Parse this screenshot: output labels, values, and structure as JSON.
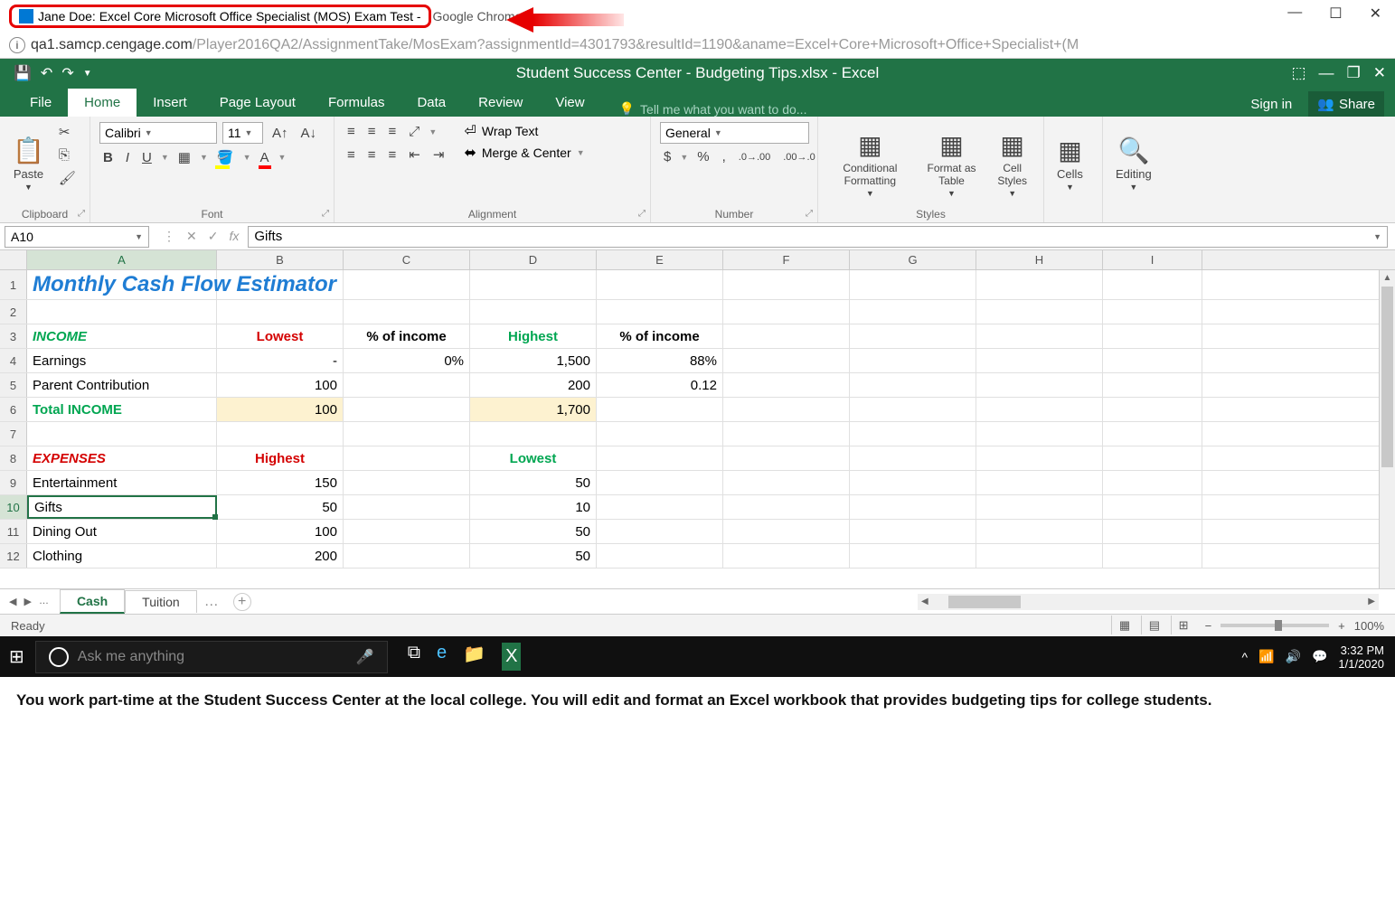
{
  "browser": {
    "title_highlighted": "Jane Doe: Excel Core Microsoft Office Specialist (MOS) Exam Test -",
    "title_rest": " Google Chrome",
    "url_host": "qa1.samcp.cengage.com",
    "url_path": "/Player2016QA2/AssignmentTake/MosExam?assignmentId=4301793&resultId=1190&aname=Excel+Core+Microsoft+Office+Specialist+(M",
    "win_minimize": "—",
    "win_maximize": "☐",
    "win_close": "✕"
  },
  "excel": {
    "doc_title": "Student Success Center - Budgeting Tips.xlsx - Excel",
    "tabs": [
      "File",
      "Home",
      "Insert",
      "Page Layout",
      "Formulas",
      "Data",
      "Review",
      "View"
    ],
    "active_tab": "Home",
    "tell_me": "Tell me what you want to do...",
    "sign_in": "Sign in",
    "share": "Share"
  },
  "ribbon": {
    "clipboard": {
      "label": "Clipboard",
      "paste": "Paste"
    },
    "font": {
      "label": "Font",
      "name": "Calibri",
      "size": "11",
      "bold": "B",
      "italic": "I",
      "underline": "U"
    },
    "alignment": {
      "label": "Alignment",
      "wrap": "Wrap Text",
      "merge": "Merge & Center"
    },
    "number": {
      "label": "Number",
      "format": "General"
    },
    "styles": {
      "label": "Styles",
      "cond": "Conditional Formatting",
      "table": "Format as Table",
      "cell": "Cell Styles"
    },
    "cells": {
      "label": "Cells"
    },
    "editing": {
      "label": "Editing"
    }
  },
  "formula_bar": {
    "name_box": "A10",
    "formula": "Gifts"
  },
  "grid": {
    "columns": [
      "A",
      "B",
      "C",
      "D",
      "E",
      "F",
      "G",
      "H",
      "I"
    ],
    "active_col": "A",
    "active_row": "10",
    "rows": [
      {
        "n": "1",
        "A": "Monthly Cash Flow Estimator",
        "class_A": "title-cell",
        "tall": true
      },
      {
        "n": "2"
      },
      {
        "n": "3",
        "A": "INCOME",
        "class_A": "section-green",
        "B": "Lowest",
        "class_B": "hdr-red ctr",
        "C": "% of income",
        "class_C": "hdr-black ctr",
        "D": "Highest",
        "class_D": "hdr-green ctr",
        "E": "% of income",
        "class_E": "hdr-black ctr"
      },
      {
        "n": "4",
        "A": "  Earnings",
        "B": "-",
        "class_B": "num",
        "C": "0%",
        "class_C": "num",
        "D": "1,500",
        "class_D": "num",
        "E": "88%",
        "class_E": "num"
      },
      {
        "n": "5",
        "A": "  Parent Contribution",
        "B": "100",
        "class_B": "num",
        "D": "200",
        "class_D": "num",
        "E": "0.12",
        "class_E": "num"
      },
      {
        "n": "6",
        "A": "Total INCOME",
        "class_A": "total-row",
        "B": "100",
        "class_B": "num highlight",
        "D": "1,700",
        "class_D": "num highlight"
      },
      {
        "n": "7"
      },
      {
        "n": "8",
        "A": "EXPENSES",
        "class_A": "section-red",
        "B": "Highest",
        "class_B": "hdr-red ctr",
        "D": "Lowest",
        "class_D": "hdr-green ctr"
      },
      {
        "n": "9",
        "A": "  Entertainment",
        "B": "150",
        "class_B": "num",
        "D": "50",
        "class_D": "num"
      },
      {
        "n": "10",
        "A": "  Gifts",
        "class_A": "selected-cell",
        "B": "50",
        "class_B": "num",
        "D": "10",
        "class_D": "num"
      },
      {
        "n": "11",
        "A": "  Dining Out",
        "B": "100",
        "class_B": "num",
        "D": "50",
        "class_D": "num"
      },
      {
        "n": "12",
        "A": "  Clothing",
        "B": "200",
        "class_B": "num",
        "D": "50",
        "class_D": "num"
      }
    ]
  },
  "sheets": {
    "tabs": [
      "Cash",
      "Tuition"
    ],
    "active": "Cash",
    "ellipsis": "…"
  },
  "status": {
    "ready": "Ready",
    "zoom": "100%"
  },
  "taskbar": {
    "cortana": "Ask me anything",
    "time": "3:32 PM",
    "date": "1/1/2020"
  },
  "instructions": "You work part-time at the Student Success Center at the local college. You will edit and format an Excel workbook that provides budgeting tips for college students."
}
